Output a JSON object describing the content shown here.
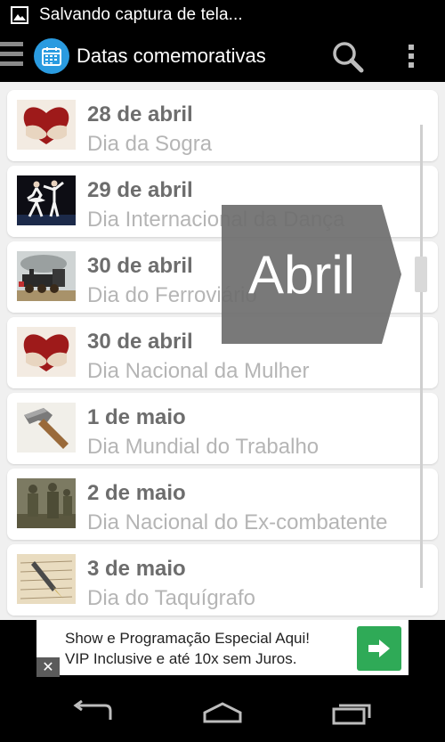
{
  "status_bar": {
    "text": "Salvando captura de tela...",
    "icon": "image-icon"
  },
  "action_bar": {
    "title": "Datas comemorativas",
    "app_icon": "calendar-icon",
    "search_icon": "search-icon",
    "overflow_icon": "overflow-menu-icon",
    "drawer_icon": "drawer-menu-icon"
  },
  "list": {
    "items": [
      {
        "date": "28 de abril",
        "title": "Dia da Sogra",
        "thumb": "heart-hug-thumbnail"
      },
      {
        "date": "29 de abril",
        "title": "Dia Internacional da Dança",
        "thumb": "ballet-dancers-thumbnail"
      },
      {
        "date": "30 de abril",
        "title": "Dia do Ferroviário",
        "thumb": "steam-train-thumbnail"
      },
      {
        "date": "30 de abril",
        "title": "Dia Nacional da Mulher",
        "thumb": "heart-hug-thumbnail"
      },
      {
        "date": "1 de maio",
        "title": "Dia Mundial do Trabalho",
        "thumb": "hammer-thumbnail"
      },
      {
        "date": "2 de maio",
        "title": "Dia Nacional do Ex-combatente",
        "thumb": "soldiers-thumbnail"
      },
      {
        "date": "3 de maio",
        "title": "Dia do Taquígrafo",
        "thumb": "fountain-pen-thumbnail"
      }
    ],
    "month_indicator": "Abril"
  },
  "ad": {
    "line1": "Show e Programação Especial Aqui!",
    "line2": "VIP Inclusive e até 10x sem Juros.",
    "button_icon": "arrow-right-icon",
    "close_label": "✕",
    "accent_color": "#2faa57"
  },
  "nav_bar": {
    "back_icon": "back-icon",
    "home_icon": "home-icon",
    "recents_icon": "recents-icon"
  }
}
